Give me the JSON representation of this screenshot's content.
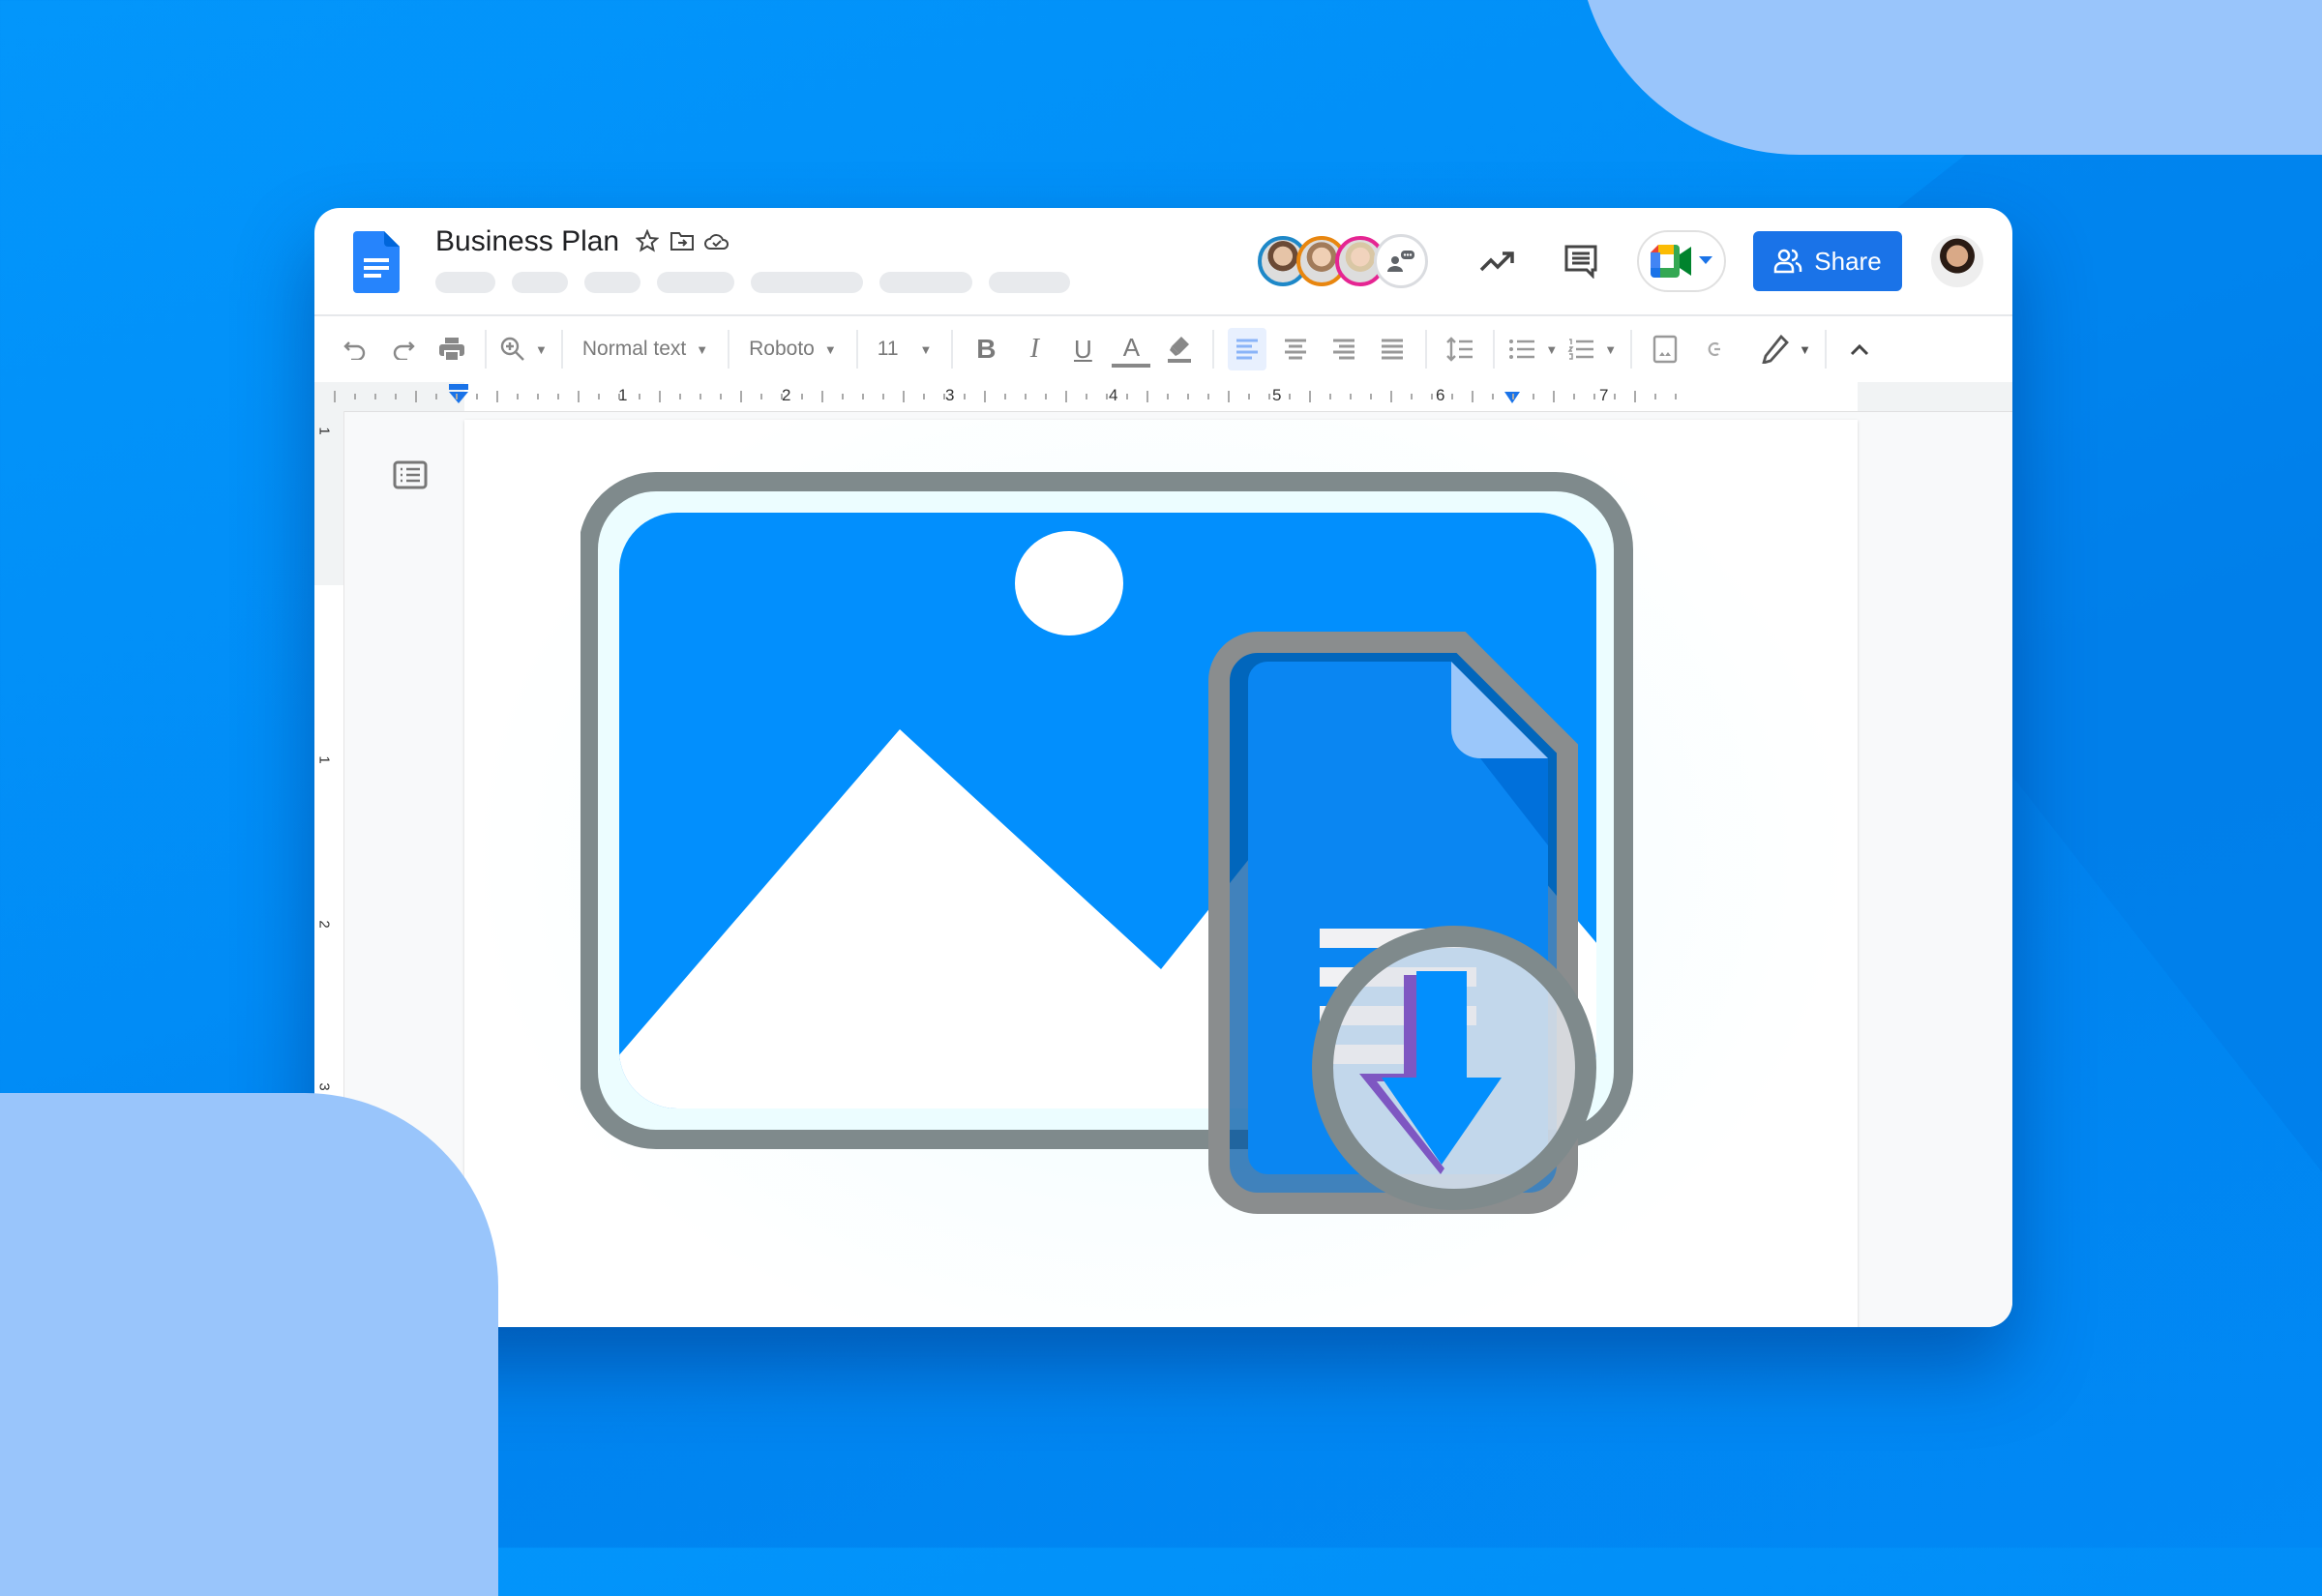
{
  "document": {
    "title": "Business Plan",
    "title_icons": [
      "star-icon",
      "move-to-folder-icon",
      "cloud-saved-icon"
    ],
    "menu_placeholders": 7
  },
  "header": {
    "collaborators": [
      {
        "name": "collaborator-1",
        "ring_color": "#1e88c8"
      },
      {
        "name": "collaborator-2",
        "ring_color": "#e8860f"
      },
      {
        "name": "collaborator-3",
        "ring_color": "#e52592"
      }
    ],
    "icons": [
      "chat-presence-icon",
      "activity-trend-icon",
      "comments-icon",
      "google-meet-icon"
    ],
    "share_label": "Share",
    "share_color": "#1a73e8"
  },
  "toolbar": {
    "style_value": "Normal text",
    "font_value": "Roboto",
    "size_value": "11",
    "bold": "B",
    "italic": "I",
    "underline": "U",
    "text_color": "A"
  },
  "ruler": {
    "horizontal_labels": [
      "1",
      "2",
      "3",
      "4",
      "5",
      "6",
      "7"
    ],
    "vertical_labels": [
      "1",
      "1",
      "2",
      "3"
    ]
  },
  "illustration": {
    "subject": "image-to-google-doc-download",
    "accent_color": "#028ffd",
    "frame_color": "#7f8a8c"
  }
}
